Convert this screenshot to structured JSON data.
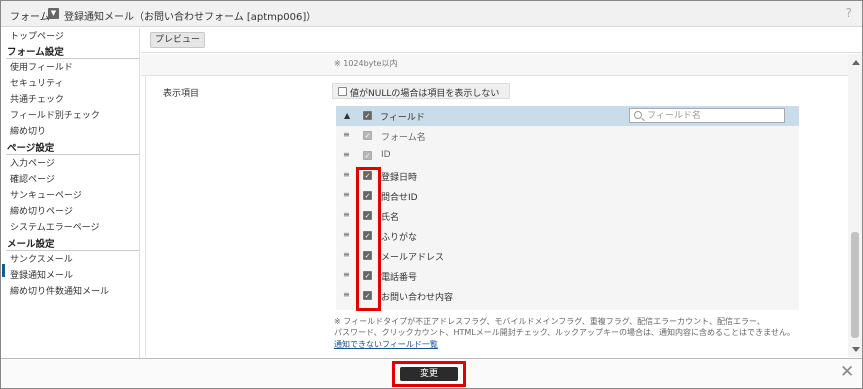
{
  "title": {
    "prefix": "フォーム",
    "dropdown_icon": "chevron-down-icon",
    "text": "登録通知メール（お問い合わせフォーム [aptmp006]）",
    "help": "?"
  },
  "sidebar": {
    "top": "トップページ",
    "sections": [
      {
        "heading": "フォーム設定",
        "items": [
          "使用フィールド",
          "セキュリティ",
          "共通チェック",
          "フィールド別チェック",
          "締め切り"
        ]
      },
      {
        "heading": "ページ設定",
        "items": [
          "入力ページ",
          "確認ページ",
          "サンキューページ",
          "締め切りページ",
          "システムエラーページ"
        ]
      },
      {
        "heading": "メール設定",
        "items": [
          "サンクスメール",
          "登録通知メール",
          "締め切り件数通知メール"
        ]
      }
    ],
    "active_item": "登録通知メール"
  },
  "toolbar": {
    "preview_label": "プレビュー"
  },
  "main": {
    "byte_note": "※ 1024byte以内",
    "field_label": "表示項目",
    "null_checkbox_label": "値がNULLの場合は項目を表示しない",
    "table": {
      "sort_icon": "▲",
      "header_label": "フィールド",
      "search_placeholder": "フィールド名",
      "rows": [
        {
          "label": "フォーム名",
          "checked": true,
          "disabled": true
        },
        {
          "label": "ID",
          "checked": true,
          "disabled": true
        },
        {
          "label": "登録日時",
          "checked": true,
          "disabled": false
        },
        {
          "label": "問合せID",
          "checked": true,
          "disabled": false
        },
        {
          "label": "氏名",
          "checked": true,
          "disabled": false
        },
        {
          "label": "ふりがな",
          "checked": true,
          "disabled": false
        },
        {
          "label": "メールアドレス",
          "checked": true,
          "disabled": false
        },
        {
          "label": "電話番号",
          "checked": true,
          "disabled": false
        },
        {
          "label": "お問い合わせ内容",
          "checked": true,
          "disabled": false
        }
      ]
    },
    "note_line1": "※ フィールドタイプが不正アドレスフラグ、モバイルドメインフラグ、重複フラグ、配信エラーカウント、配信エラー、",
    "note_line2": "パスワード、クリックカウント、HTMLメール開封チェック、ルックアップキーの場合は、通知内容に含めることはできません。",
    "link_text": "通知できないフィールド一覧"
  },
  "footer": {
    "change_label": "変更",
    "close_icon": "close-icon"
  },
  "colors": {
    "highlight": "#e00000",
    "table_header": "#c8dde9",
    "primary_button": "#2b2b2b",
    "active": "#1a5a8e"
  }
}
